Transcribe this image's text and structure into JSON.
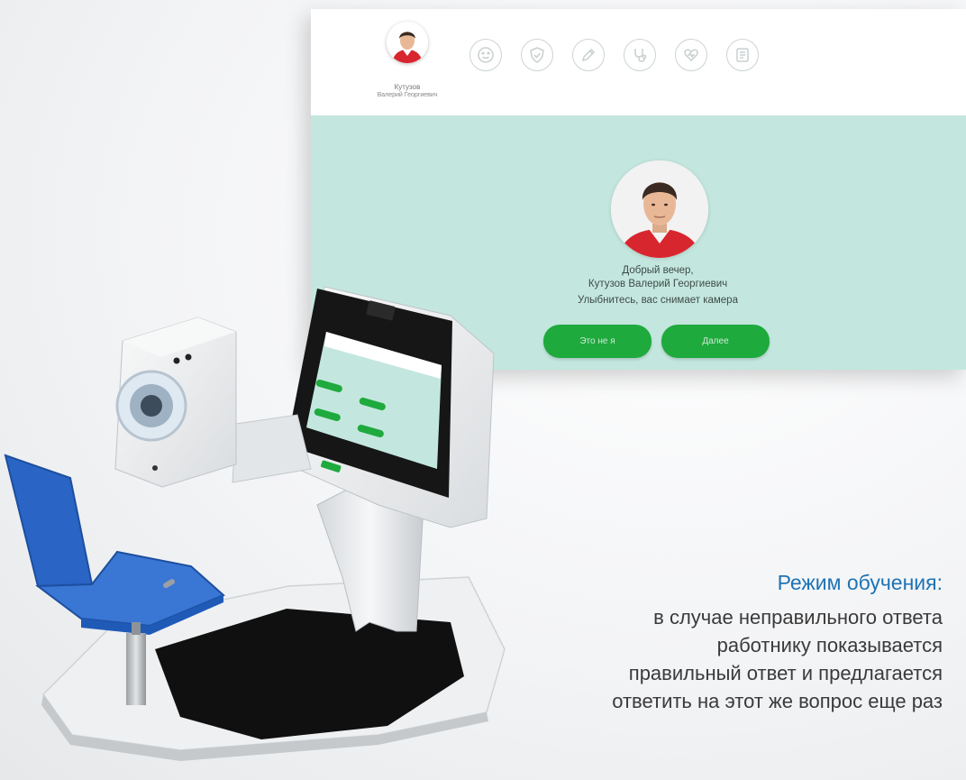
{
  "header": {
    "user_name_short": "Кутузов",
    "user_name_full": "Валерий Георгиевич",
    "nav_icons": [
      "emoji-face-icon",
      "shield-check-icon",
      "pencil-icon",
      "stethoscope-icon",
      "heart-icon",
      "document-icon"
    ]
  },
  "greeting": {
    "line1": "Добрый вечер,",
    "line2": "Кутузов Валерий Георгиевич",
    "line3": "Улыбнитесь, вас снимает камера"
  },
  "buttons": {
    "back_label": "Это не я",
    "next_label": "Далее"
  },
  "caption": {
    "title": "Режим обучения:",
    "line1": "в случае неправильного ответа",
    "line2": "работнику показывается",
    "line3": "правильный ответ и предлагается",
    "line4": "ответить на этот же вопрос еще раз"
  },
  "colors": {
    "accent_green": "#1faa3e",
    "panel_mint": "#c3e7de",
    "caption_blue": "#1e73b4",
    "uniform_red": "#d8262f"
  }
}
